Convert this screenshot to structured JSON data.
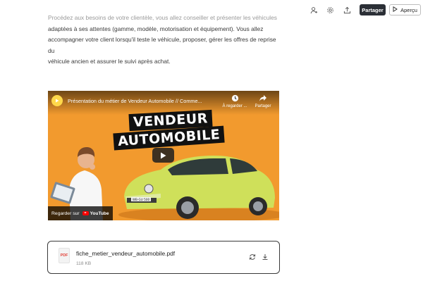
{
  "toolbar": {
    "share_label": "Partager",
    "preview_label": "Aperçu",
    "icons": [
      "user-icon",
      "gear-icon",
      "upload-icon",
      "play-outline-icon"
    ]
  },
  "content": {
    "paragraph_clipped": "Procédez aux besoins de votre clientèle, vous allez conseiller et présenter les véhicules",
    "paragraph_line2": "adaptées à ses attentes (gamme, modèle, motorisation et équipement). Vous allez",
    "paragraph_line3": "accompagner votre client lorsqu'il teste le véhicule, proposer, gérer les offres de reprise du",
    "paragraph_line4": "véhicule ancien et assurer le suivi après achat."
  },
  "video": {
    "title": "Présentation du métier de Vendeur Automobile // Comme...",
    "watch_later_label": "À regarder ...",
    "share_label": "Partager",
    "banner_line1": "VENDEUR",
    "banner_line2": "AUTOMOBILE",
    "plate": "WB-GU 500",
    "watch_on_label": "Regarder sur",
    "platform_label": "YouTube",
    "accent": "#f29a2e"
  },
  "file": {
    "name": "fiche_metier_vendeur_automobile.pdf",
    "size": "118 KB",
    "type_label": "PDF",
    "type_color": "#e2453c"
  }
}
